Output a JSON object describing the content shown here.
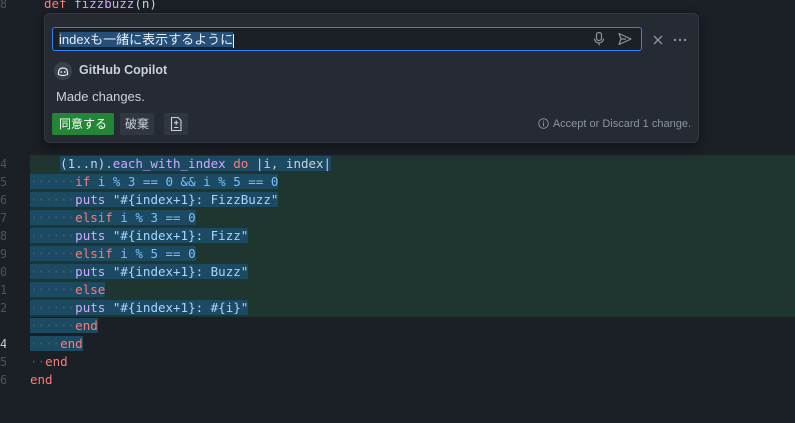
{
  "editor": {
    "gutter": [
      "8",
      "4",
      "5",
      "6",
      "7",
      "8",
      "9",
      "0",
      "1",
      "2",
      "3",
      "4",
      "5",
      "6"
    ],
    "top_line": {
      "kw": "def",
      "name": "fizzbuzz",
      "args": "(n)"
    },
    "code": {
      "l1": {
        "a": "(1..n).",
        "fn": "each_with_index",
        "do": "do",
        "b": "|i, index|"
      },
      "l2": {
        "kw": "if",
        "rest": "i % 3 == 0 && i % 5 == 0"
      },
      "l3": {
        "kw": "puts",
        "str": "\"#{index+1}: FizzBuzz\""
      },
      "l4": {
        "kw": "elsif",
        "rest": "i % 3 == 0"
      },
      "l5": {
        "kw": "puts",
        "str": "\"#{index+1}: Fizz\""
      },
      "l6": {
        "kw": "elsif",
        "rest": "i % 5 == 0"
      },
      "l7": {
        "kw": "puts",
        "str": "\"#{index+1}: Buzz\""
      },
      "l8": {
        "kw": "else"
      },
      "l9": {
        "kw": "puts",
        "str": "\"#{index+1}: #{i}\""
      },
      "l10": {
        "kw": "end"
      },
      "l11": {
        "kw": "end"
      },
      "l12": {
        "kw": "end"
      },
      "l13": {
        "kw": "end"
      }
    }
  },
  "chat": {
    "input_value": "indexも一緒に表示するように",
    "agent_name": "GitHub Copilot",
    "message": "Made changes.",
    "accept_label": "同意する",
    "discard_label": "破棄",
    "status": "Accept or Discard 1 change.",
    "colors": {
      "accent": "#2f81f7",
      "accept": "#238636"
    }
  }
}
